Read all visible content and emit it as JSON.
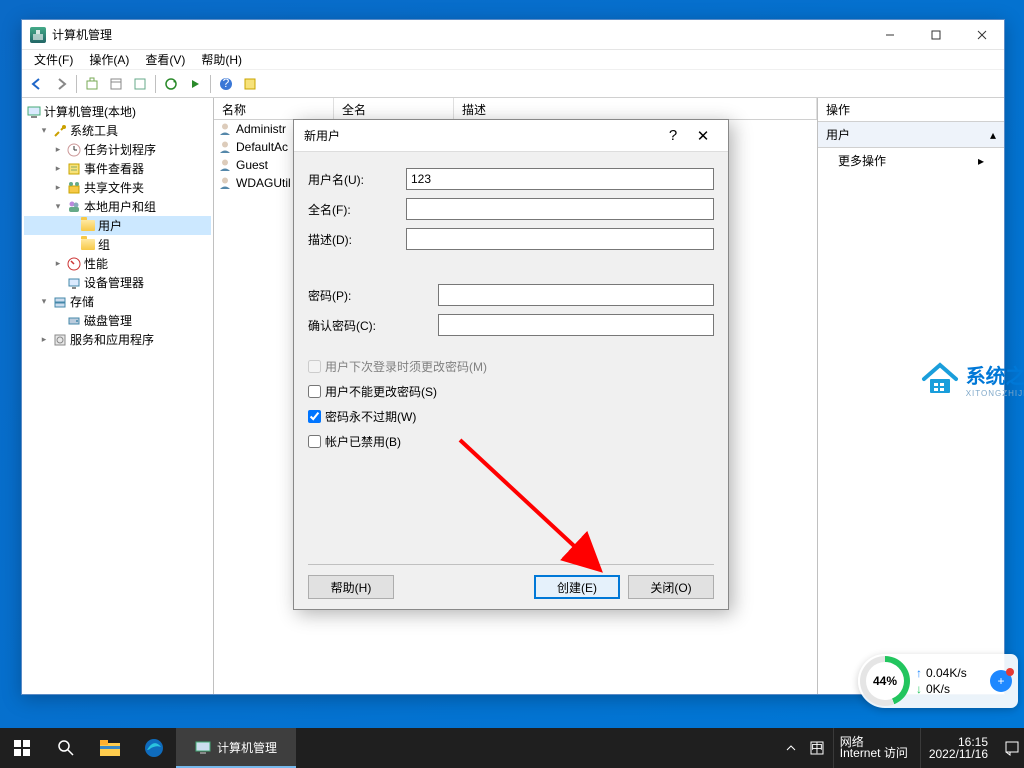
{
  "window": {
    "title": "计算机管理",
    "menus": [
      "文件(F)",
      "操作(A)",
      "查看(V)",
      "帮助(H)"
    ]
  },
  "tree": {
    "root": "计算机管理(本地)",
    "system_tools": "系统工具",
    "task_scheduler": "任务计划程序",
    "event_viewer": "事件查看器",
    "shared_folders": "共享文件夹",
    "local_users": "本地用户和组",
    "users": "用户",
    "groups": "组",
    "performance": "性能",
    "device_manager": "设备管理器",
    "storage": "存储",
    "disk_mgmt": "磁盘管理",
    "services": "服务和应用程序"
  },
  "list": {
    "col_name": "名称",
    "col_fullname": "全名",
    "col_desc": "描述",
    "rows": [
      "Administr",
      "DefaultAc",
      "Guest",
      "WDAGUtil"
    ]
  },
  "actions": {
    "header": "操作",
    "section": "用户",
    "more": "更多操作"
  },
  "dialog": {
    "title": "新用户",
    "username_label": "用户名(U):",
    "username_value": "123",
    "fullname_label": "全名(F):",
    "desc_label": "描述(D):",
    "password_label": "密码(P):",
    "confirm_label": "确认密码(C):",
    "chk_mustchange": "用户下次登录时须更改密码(M)",
    "chk_cannotchange": "用户不能更改密码(S)",
    "chk_neverexpire": "密码永不过期(W)",
    "chk_disabled": "帐户已禁用(B)",
    "btn_help": "帮助(H)",
    "btn_create": "创建(E)",
    "btn_close": "关闭(O)"
  },
  "watermark": {
    "big": "系统之家",
    "small": "XITONGZHIJIA.NE"
  },
  "meter": {
    "percent": "44%",
    "up": "0.04K/s",
    "down": "0K/s"
  },
  "taskbar": {
    "app_label": "计算机管理",
    "net_line1": "网络",
    "net_line2": "Internet 访问",
    "time": "16:15",
    "date": "2022/11/16"
  }
}
